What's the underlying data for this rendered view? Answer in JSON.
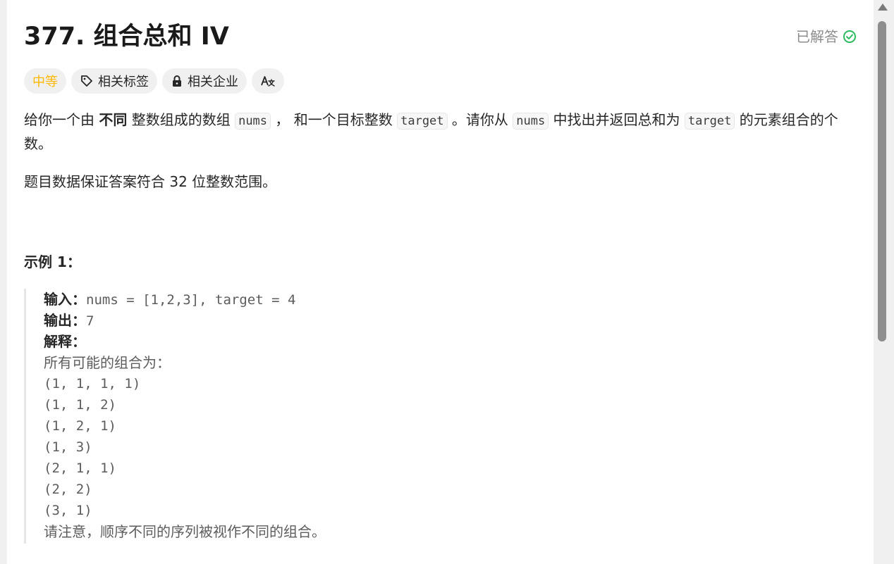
{
  "problem": {
    "title": "377. 组合总和 IV",
    "solved_label": "已解答",
    "solved_icon": "check-circle-icon"
  },
  "tags": [
    {
      "label": "中等",
      "color": "#ffb800"
    },
    {
      "label": "相关标签",
      "icon": "tag-icon"
    },
    {
      "label": "相关企业",
      "icon": "lock-icon"
    },
    {
      "label": "",
      "icon": "translate-icon"
    }
  ],
  "description": {
    "p1_a": "给你一个由 ",
    "p1_bold": "不同",
    "p1_b": " 整数组成的数组 ",
    "code_nums": "nums",
    "p1_c": " ， 和一个目标整数 ",
    "code_target": "target",
    "p1_d": " 。请你从 ",
    "code_nums2": "nums",
    "p1_e": " 中找出并返回总和为 ",
    "code_target2": "target",
    "p1_f": " 的元素组合的个数。",
    "p2": "题目数据保证答案符合 32 位整数范围。"
  },
  "example1": {
    "title": "示例 1：",
    "input_label": "输入：",
    "input_value": "nums = [1,2,3], target = 4",
    "output_label": "输出：",
    "output_value": "7",
    "explain_label": "解释：",
    "explain_intro": "所有可能的组合为：",
    "combos": [
      "(1, 1, 1, 1)",
      "(1, 1, 2)",
      "(1, 2, 1)",
      "(1, 3)",
      "(2, 1, 1)",
      "(2, 2)",
      "(3, 1)"
    ],
    "note": "请注意，顺序不同的序列被视作不同的组合。"
  },
  "colors": {
    "accent_medium": "#ffb800",
    "solved_green": "#2cbb5d"
  }
}
